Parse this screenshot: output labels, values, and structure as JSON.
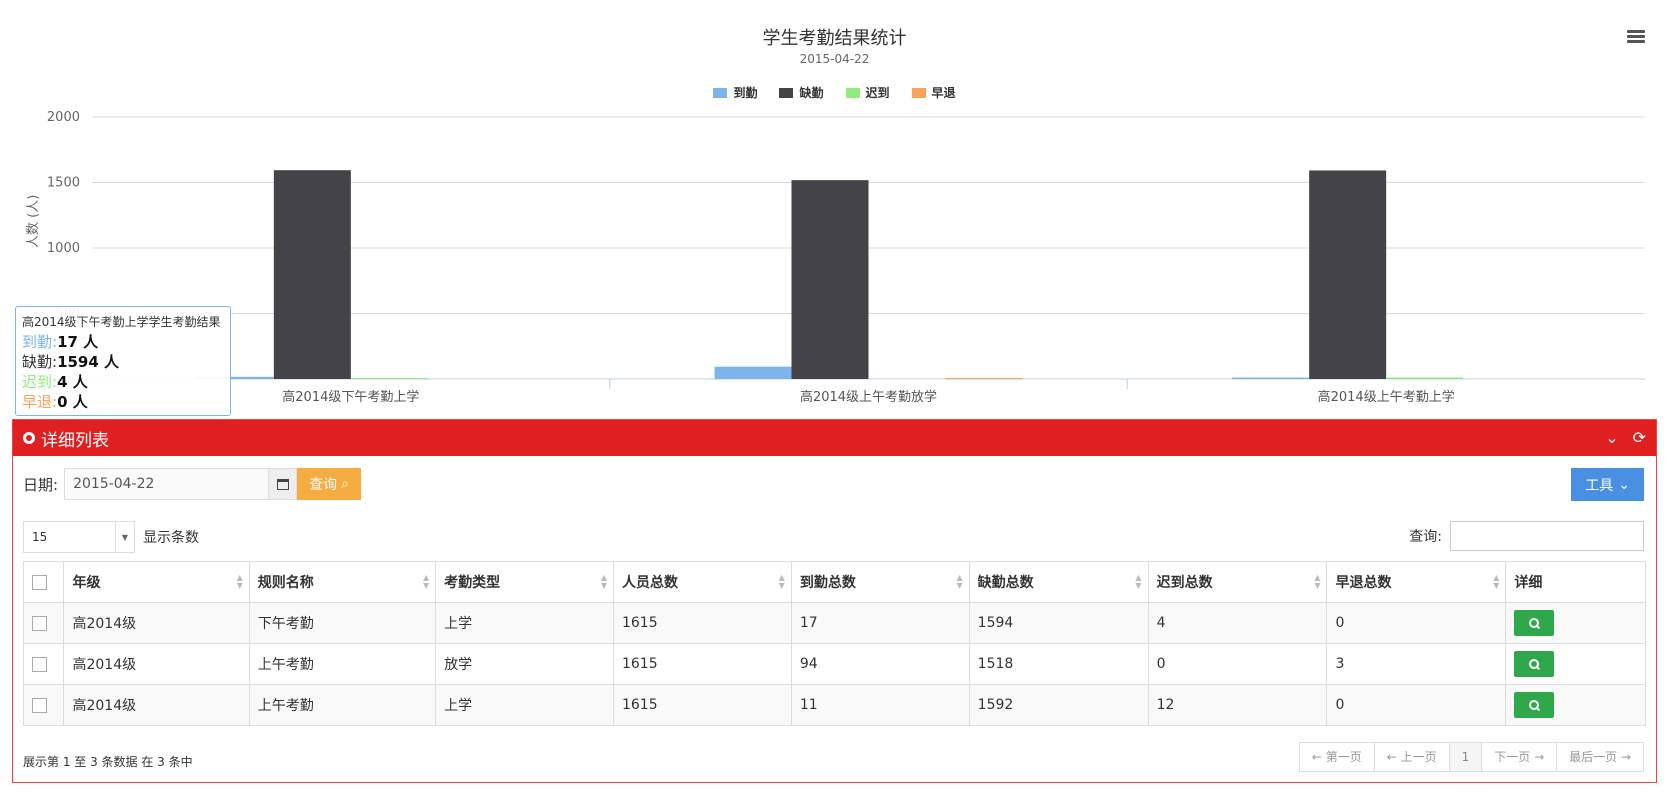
{
  "chart": {
    "title": "学生考勤结果统计",
    "subtitle": "2015-04-22",
    "ylabel": "人数 (人)",
    "legend": [
      {
        "name": "到勤",
        "color": "#7cb5ec"
      },
      {
        "name": "缺勤",
        "color": "#434348"
      },
      {
        "name": "迟到",
        "color": "#90ed7d"
      },
      {
        "name": "早退",
        "color": "#f7a35c"
      }
    ],
    "menu_icon": "hamburger-menu-icon"
  },
  "chart_data": {
    "type": "bar",
    "title": "学生考勤结果统计",
    "subtitle": "2015-04-22",
    "xlabel": "",
    "ylabel": "人数 (人)",
    "ylim": [
      0,
      2000
    ],
    "yticks": [
      0,
      500,
      1000,
      1500,
      2000
    ],
    "grid": true,
    "legend_position": "top-center",
    "categories": [
      "高2014级下午考勤上学",
      "高2014级上午考勤放学",
      "高2014级上午考勤上学"
    ],
    "series": [
      {
        "name": "到勤",
        "color": "#7cb5ec",
        "values": [
          17,
          94,
          11
        ]
      },
      {
        "name": "缺勤",
        "color": "#434348",
        "values": [
          1594,
          1518,
          1592
        ]
      },
      {
        "name": "迟到",
        "color": "#90ed7d",
        "values": [
          4,
          0,
          12
        ]
      },
      {
        "name": "早退",
        "color": "#f7a35c",
        "values": [
          0,
          3,
          0
        ]
      }
    ]
  },
  "tooltip": {
    "title": "高2014级下午考勤上学学生考勤结果",
    "rows": [
      {
        "label": "到勤:",
        "value": "17 人",
        "color": "#7cb5ec"
      },
      {
        "label": "缺勤:",
        "value": "1594 人",
        "color": "#333333"
      },
      {
        "label": "迟到:",
        "value": "4 人",
        "color": "#90ed7d"
      },
      {
        "label": "早退:",
        "value": "0 人",
        "color": "#f7a35c"
      }
    ]
  },
  "panel": {
    "title": "详细列表",
    "header_color": "#e02020",
    "date_label": "日期:",
    "date_value": "2015-04-22",
    "query_label": "查询",
    "tools_label": "工具",
    "page_size": "15",
    "page_size_label": "显示条数",
    "search_label": "查询:",
    "search_value": "",
    "columns": [
      "年级",
      "规则名称",
      "考勤类型",
      "人员总数",
      "到勤总数",
      "缺勤总数",
      "迟到总数",
      "早退总数",
      "详细"
    ],
    "rows": [
      [
        "高2014级",
        "下午考勤",
        "上学",
        "1615",
        "17",
        "1594",
        "4",
        "0"
      ],
      [
        "高2014级",
        "上午考勤",
        "放学",
        "1615",
        "94",
        "1518",
        "0",
        "3"
      ],
      [
        "高2014级",
        "上午考勤",
        "上学",
        "1615",
        "11",
        "1592",
        "12",
        "0"
      ]
    ],
    "info": "展示第 1 至 3 条数据 在 3 条中",
    "pager": {
      "first": "← 第一页",
      "prev": "← 上一页",
      "current": "1",
      "next": "下一页 →",
      "last": "最后一页 →"
    },
    "detail_button_color": "#2ea84a"
  }
}
